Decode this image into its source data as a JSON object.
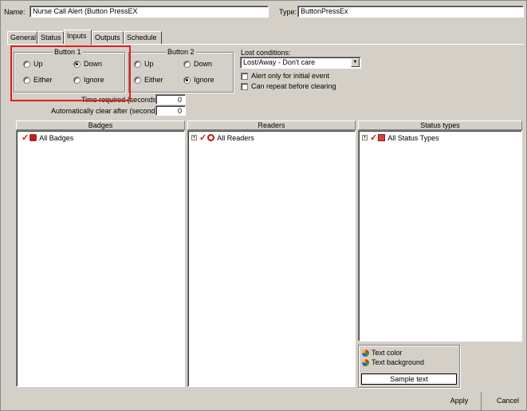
{
  "header": {
    "name_label": "Name:",
    "name_value": "Nurse Call Alert (Button PressEX",
    "type_label": "Type:",
    "type_value": "ButtonPressEx"
  },
  "tabs": [
    {
      "label": "General"
    },
    {
      "label": "Status"
    },
    {
      "label": "Inputs"
    },
    {
      "label": "Outputs"
    },
    {
      "label": "Schedule"
    }
  ],
  "button1": {
    "title": "Button 1",
    "up": "Up",
    "down": "Down",
    "either": "Either",
    "ignore": "Ignore",
    "selected": "Down"
  },
  "button2": {
    "title": "Button 2",
    "up": "Up",
    "down": "Down",
    "either": "Either",
    "ignore": "Ignore",
    "selected": "Ignore"
  },
  "lost": {
    "label": "Lost conditions:",
    "value": "Lost/Away - Don't care",
    "alert_only_label": "Alert only for initial event",
    "can_repeat_label": "Can repeat before clearing"
  },
  "timing": {
    "time_required_label": "Time required (seconds):",
    "time_required_value": "0",
    "auto_clear_label": "Automatically clear after (seconds):",
    "auto_clear_value": "0"
  },
  "panels": {
    "badges": {
      "header": "Badges",
      "item": "All Badges"
    },
    "readers": {
      "header": "Readers",
      "item": "All Readers"
    },
    "status_types": {
      "header": "Status types",
      "item": "All Status Types"
    }
  },
  "colors_box": {
    "text_color": "Text color",
    "text_background": "Text background",
    "sample_text": "Sample text"
  },
  "footer": {
    "apply": "Apply",
    "cancel": "Cancel"
  },
  "colors": {
    "window_bg": "#d4d0c8",
    "highlight": "#e02020"
  }
}
